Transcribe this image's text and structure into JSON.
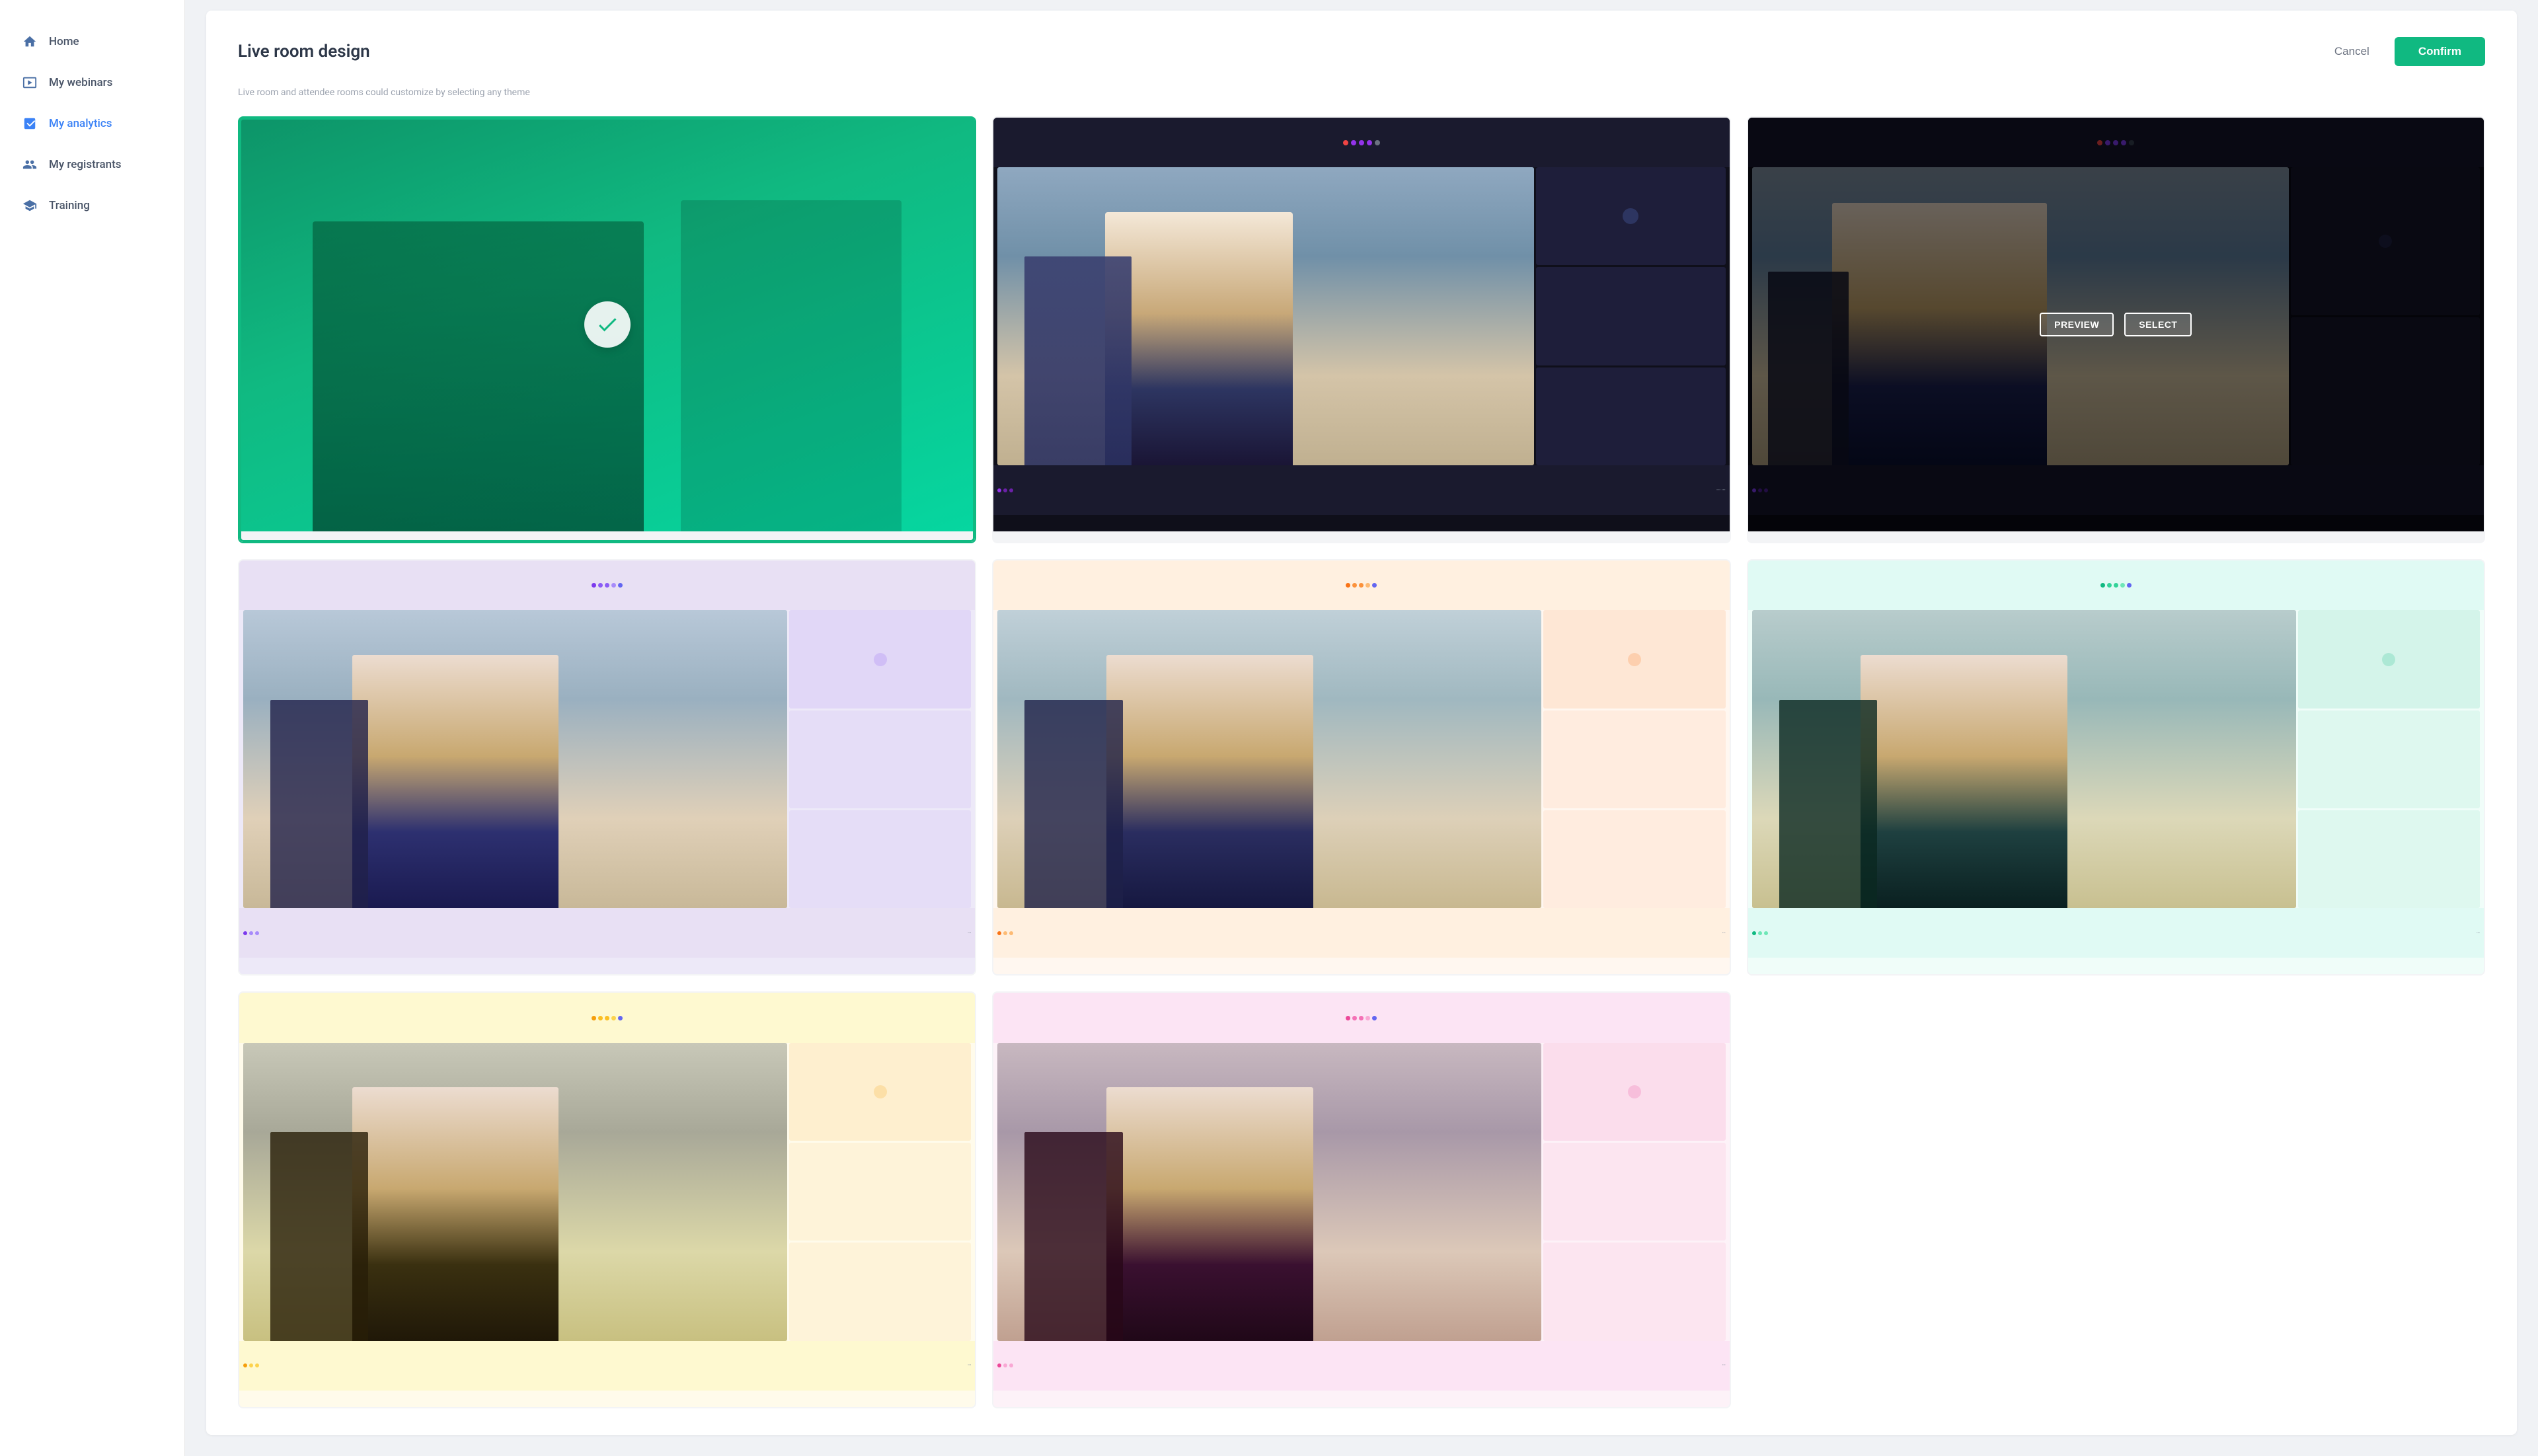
{
  "sidebar": {
    "items": [
      {
        "id": "home",
        "label": "Home",
        "icon": "home"
      },
      {
        "id": "my-webinars",
        "label": "My webinars",
        "icon": "webinar"
      },
      {
        "id": "my-analytics",
        "label": "My analytics",
        "icon": "analytics",
        "active": true
      },
      {
        "id": "my-registrants",
        "label": "My registrants",
        "icon": "registrants"
      },
      {
        "id": "training",
        "label": "Training",
        "icon": "training"
      }
    ]
  },
  "page": {
    "title": "Live room design",
    "subtitle": "Live room and attendee rooms could customize by selecting any theme",
    "cancel_label": "Cancel",
    "confirm_label": "Confirm"
  },
  "themes": {
    "preview_label": "PREVIEW",
    "select_label": "SELECT",
    "items": [
      {
        "id": "teal-selected",
        "style": "teal",
        "selected": true,
        "row": 1
      },
      {
        "id": "dark-mid",
        "style": "dark",
        "selected": false,
        "row": 1
      },
      {
        "id": "dark-hover",
        "style": "dark-hover",
        "selected": false,
        "row": 1
      },
      {
        "id": "purple-light",
        "style": "purple",
        "selected": false,
        "row": 2
      },
      {
        "id": "orange-light",
        "style": "orange",
        "selected": false,
        "row": 2
      },
      {
        "id": "teal-light",
        "style": "teal-light",
        "selected": false,
        "row": 2
      },
      {
        "id": "yellow-light",
        "style": "yellow",
        "selected": false,
        "row": 3
      },
      {
        "id": "pink-light",
        "style": "pink",
        "selected": false,
        "row": 3
      }
    ]
  }
}
